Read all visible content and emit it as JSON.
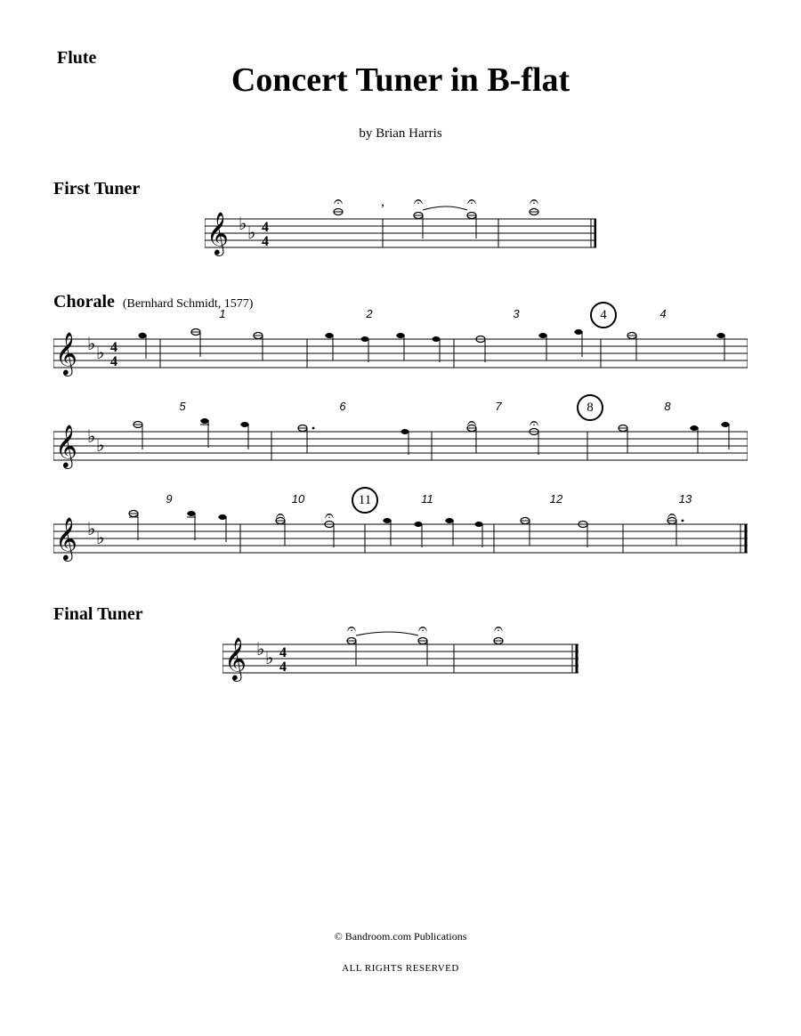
{
  "instrument": "Flute",
  "title": "Concert Tuner in B-flat",
  "composer": "by Brian Harris",
  "sections": {
    "firstTuner": {
      "heading": "First Tuner"
    },
    "chorale": {
      "heading": "Chorale",
      "sub": "(Bernhard Schmidt, 1577)",
      "line1": {
        "measures": [
          "1",
          "2",
          "3",
          "4"
        ],
        "rehearsal": "4"
      },
      "line2": {
        "measures": [
          "5",
          "6",
          "7",
          "8"
        ],
        "rehearsal": "8"
      },
      "line3": {
        "measures": [
          "9",
          "10",
          "11",
          "12",
          "13"
        ],
        "rehearsal": "11"
      }
    },
    "finalTuner": {
      "heading": "Final Tuner"
    }
  },
  "footer": {
    "copyright": "© Bandroom.com Publications",
    "rights": "ALL RIGHTS RESERVED"
  }
}
